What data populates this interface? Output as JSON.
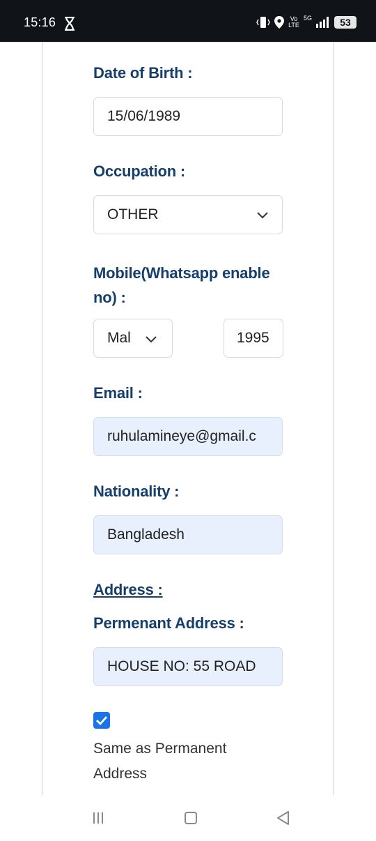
{
  "status": {
    "time": "15:16",
    "icons": [
      "hourglass-icon",
      "vibrate-icon",
      "location-icon",
      "volte-icon",
      "signal-5g-icon",
      "battery-icon"
    ],
    "volte_top": "Vo",
    "volte_bottom": "LTE",
    "network": "5G",
    "battery": "53"
  },
  "form": {
    "dob": {
      "label": "Date of Birth :",
      "value": "15/06/1989"
    },
    "occupation": {
      "label": "Occupation :",
      "value": "OTHER"
    },
    "mobile": {
      "label_line1": "Mobile(Whatsapp enable",
      "label_line2": "no) :",
      "country": "Mal",
      "number": "1995"
    },
    "email": {
      "label": "Email :",
      "value": "ruhulamineye@gmail.c"
    },
    "nationality": {
      "label": "Nationality :",
      "value": "Bangladesh"
    },
    "address": {
      "heading": "Address :",
      "permanent_label": "Permenant Address :",
      "permanent_value": "HOUSE NO: 55 ROAD",
      "same_label": "Same as Permanent Address",
      "same_checked": true
    }
  },
  "colors": {
    "label": "#173f6a",
    "autofill": "#e8f0fe",
    "checkbox": "#1a73e8",
    "status_bg": "#101418"
  },
  "nav": {
    "buttons": [
      "recents-icon",
      "home-icon",
      "back-icon"
    ]
  }
}
